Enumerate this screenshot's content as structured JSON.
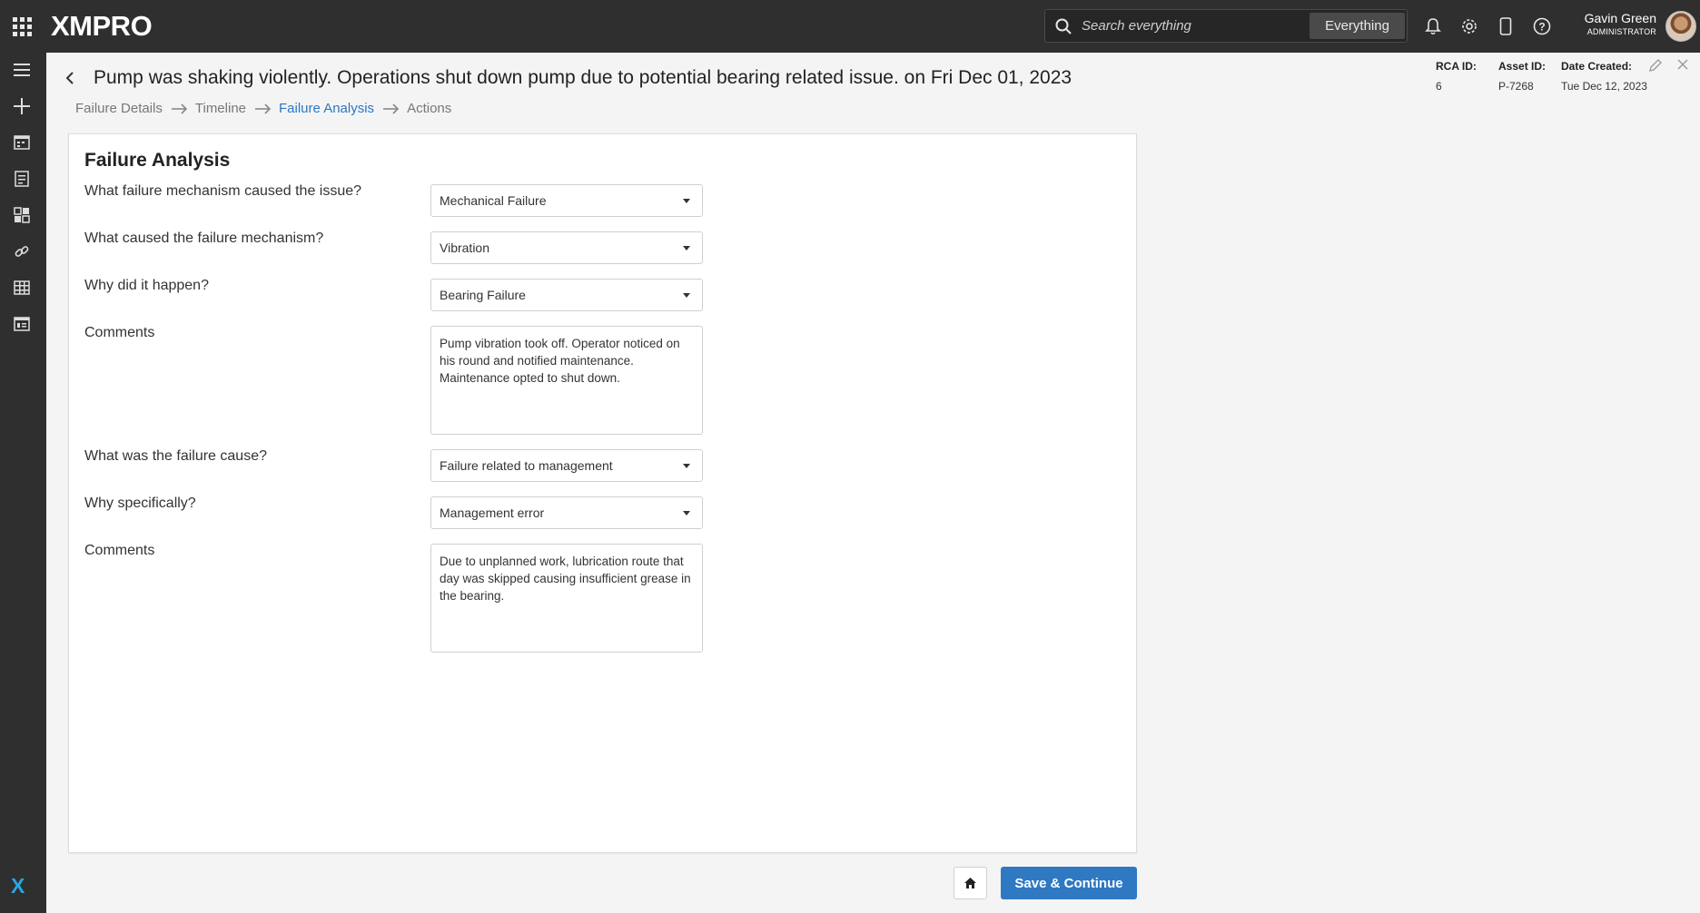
{
  "app": {
    "logo": "XMPRO",
    "apps_icon": "app-grid-icon"
  },
  "search": {
    "placeholder": "Search everything",
    "scope": "Everything"
  },
  "top_icons": [
    "bell-icon",
    "gear-icon",
    "mobile-icon",
    "help-icon"
  ],
  "user": {
    "name": "Gavin Green",
    "role": "ADMINISTRATOR"
  },
  "sidenav": {
    "items": [
      "menu-icon",
      "add-icon",
      "calendar-icon",
      "notes-icon",
      "dashboard-icon",
      "link-icon",
      "table-icon",
      "list-icon"
    ],
    "bottom_logo": "X"
  },
  "header": {
    "title": "Pump was shaking violently. Operations shut down pump due to potential bearing related issue. on Fri Dec 01, 2023",
    "breadcrumbs": [
      "Failure Details",
      "Timeline",
      "Failure Analysis",
      "Actions"
    ],
    "active_breadcrumb": "Failure Analysis"
  },
  "meta": {
    "rca_label": "RCA ID:",
    "rca_value": "6",
    "asset_label": "Asset ID:",
    "asset_value": "P-7268",
    "date_label": "Date Created:",
    "date_value": "Tue Dec 12, 2023"
  },
  "form": {
    "title": "Failure Analysis",
    "q1": {
      "label": "What failure mechanism caused the issue?",
      "value": "Mechanical Failure"
    },
    "q2": {
      "label": "What caused the failure mechanism?",
      "value": "Vibration"
    },
    "q3": {
      "label": "Why did it happen?",
      "value": "Bearing Failure"
    },
    "c1": {
      "label": "Comments",
      "value": "Pump vibration took off. Operator noticed on his round and notified maintenance. Maintenance opted to shut down."
    },
    "q4": {
      "label": "What was the failure cause?",
      "value": "Failure related to management"
    },
    "q5": {
      "label": "Why specifically?",
      "value": "Management error"
    },
    "c2": {
      "label": "Comments",
      "value": "Due to unplanned work, lubrication route that day was skipped causing insufficient grease in the bearing."
    }
  },
  "footer": {
    "save_label": "Save & Continue",
    "home_icon": "home-icon"
  }
}
